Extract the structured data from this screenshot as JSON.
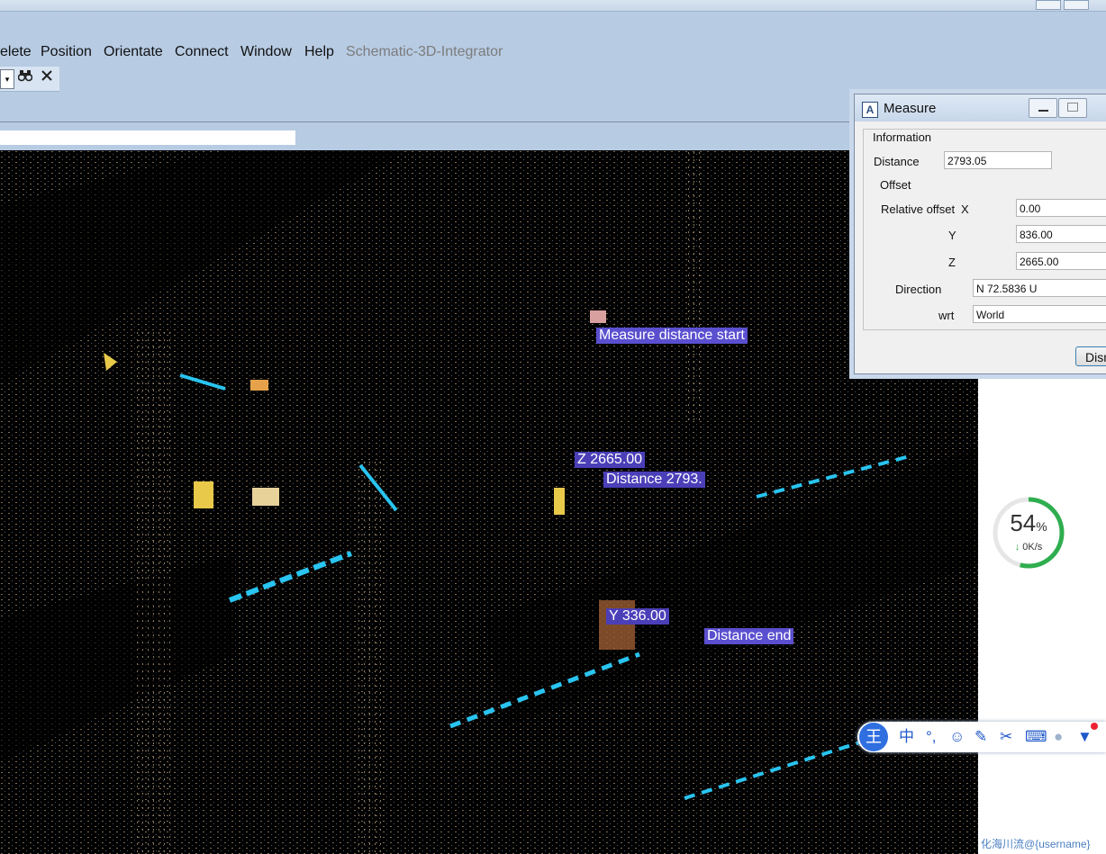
{
  "menu": {
    "items": [
      "elete",
      "Position",
      "Orientate",
      "Connect",
      "Window",
      "Help"
    ],
    "app_name": "Schematic-3D-Integrator"
  },
  "toolbar": {
    "dropdown_arrow": "▾",
    "binoculars_icon": "binoculars-icon",
    "close_icon": "close-icon"
  },
  "viewport_labels": {
    "measure_start": "Measure distance start",
    "z_value": "Z 2665.00",
    "distance": "Distance 2793.",
    "y_value": "Y 336.00",
    "distance_end": "Distance end"
  },
  "measure_dialog": {
    "title": "Measure",
    "information_label": "Information",
    "distance_label": "Distance",
    "distance_value": "2793.05",
    "offset_label": "Offset",
    "relative_offset_label": "Relative offset",
    "x_label": "X",
    "x_value": "0.00",
    "y_label": "Y",
    "y_value": "836.00",
    "z_label": "Z",
    "z_value": "2665.00",
    "direction_label": "Direction",
    "direction_value": "N 72.5836 U",
    "wrt_label": "wrt",
    "wrt_value": "World",
    "dismiss_label": "Dism"
  },
  "net_widget": {
    "percent": "54",
    "percent_sign": "%",
    "rate": "0K/s",
    "progress_fraction": 0.54
  },
  "ime_bar": {
    "logo": "王",
    "chinese_mode": "中",
    "punct": "°,",
    "emoji_icon": "smile-icon",
    "pen_icon": "pen-icon",
    "scissors_icon": "scissors-icon",
    "keyboard_icon": "keyboard-icon",
    "user_icon": "user-icon",
    "shirt_icon": "shirt-icon"
  },
  "watermark": "化海川流@{username}",
  "colors": {
    "viewport_bg": "#000000",
    "accent_cyan": "#29c4f0",
    "overlay_label": "#5a4fcf",
    "gauge_green": "#2fae4f"
  }
}
